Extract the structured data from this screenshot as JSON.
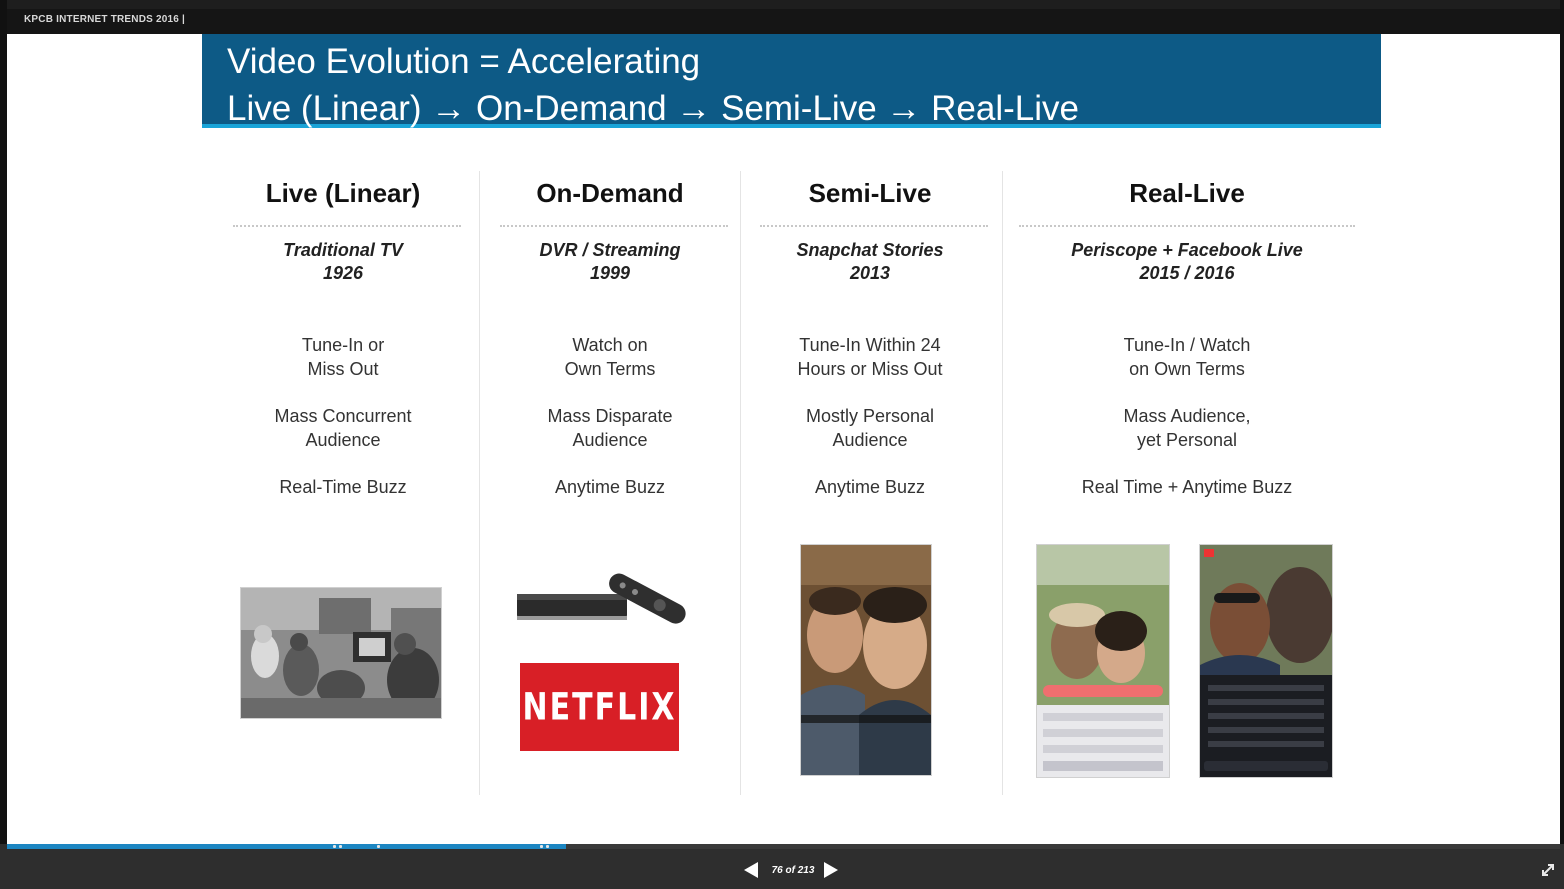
{
  "header": {
    "brand": "KPCB INTERNET TRENDS 2016 |"
  },
  "slide": {
    "title_line1": "Video Evolution = Accelerating",
    "title_line2": "Live (Linear) → On-Demand → Semi-Live → Real-Live",
    "columns": [
      {
        "heading": "Live (Linear)",
        "sub1": "Traditional TV",
        "sub2": "1926",
        "f1a": "Tune-In or",
        "f1b": "Miss Out",
        "f2a": "Mass Concurrent",
        "f2b": "Audience",
        "f3": "Real-Time Buzz"
      },
      {
        "heading": "On-Demand",
        "sub1": "DVR / Streaming",
        "sub2": "1999",
        "f1a": "Watch on",
        "f1b": "Own Terms",
        "f2a": "Mass Disparate",
        "f2b": "Audience",
        "f3": "Anytime Buzz"
      },
      {
        "heading": "Semi-Live",
        "sub1": "Snapchat Stories",
        "sub2": "2013",
        "f1a": "Tune-In Within 24",
        "f1b": "Hours or Miss Out",
        "f2a": "Mostly Personal",
        "f2b": "Audience",
        "f3": "Anytime Buzz"
      },
      {
        "heading": "Real-Live",
        "sub1": "Periscope + Facebook Live",
        "sub2": "2015 / 2016",
        "f1a": "Tune-In / Watch",
        "f1b": "on Own Terms",
        "f2a": "Mass Audience,",
        "f2b": "yet Personal",
        "f3": "Real Time + Anytime Buzz"
      }
    ],
    "netflix_logo": "NETFLIX"
  },
  "viewer": {
    "page_indicator": "76 of 213",
    "progress_fraction": 0.36,
    "icons": [
      "prev-slide-icon",
      "next-slide-icon",
      "expand-icon"
    ]
  },
  "colors": {
    "title_band": "#0d5a86",
    "accent": "#19a4d8",
    "netflix": "#d81f26",
    "progress": "#1c86c2"
  }
}
